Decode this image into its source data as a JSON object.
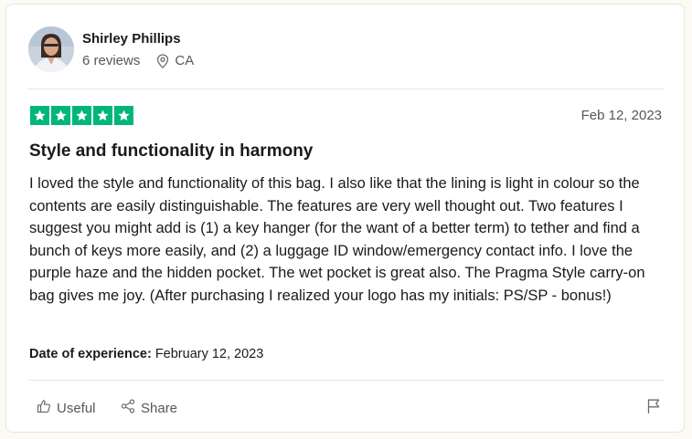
{
  "reviewer": {
    "name": "Shirley Phillips",
    "reviews": "6 reviews",
    "location": "CA"
  },
  "review": {
    "rating": 5,
    "rating_max": 5,
    "star_color": "#00b67a",
    "date": "Feb 12, 2023",
    "title": "Style and functionality in harmony",
    "body": "I loved the style and functionality of this bag. I also like that the lining is light in colour so the contents are easily distinguishable. The features are very well thought out. Two features I suggest you might add is (1) a key hanger (for the want of a better term) to tether and find a bunch of keys more easily, and (2) a luggage ID window/emergency contact info. I love the purple haze and the hidden pocket. The wet pocket is great also. The Pragma Style carry-on bag gives me joy. (After purchasing I realized your logo has my initials: PS/SP - bonus!)",
    "experience_label": "Date of experience:",
    "experience_date": "February 12, 2023"
  },
  "actions": {
    "useful": "Useful",
    "share": "Share"
  },
  "icons": {
    "location": "location-pin-icon",
    "useful": "thumbs-up-icon",
    "share": "share-icon",
    "report": "flag-icon"
  }
}
